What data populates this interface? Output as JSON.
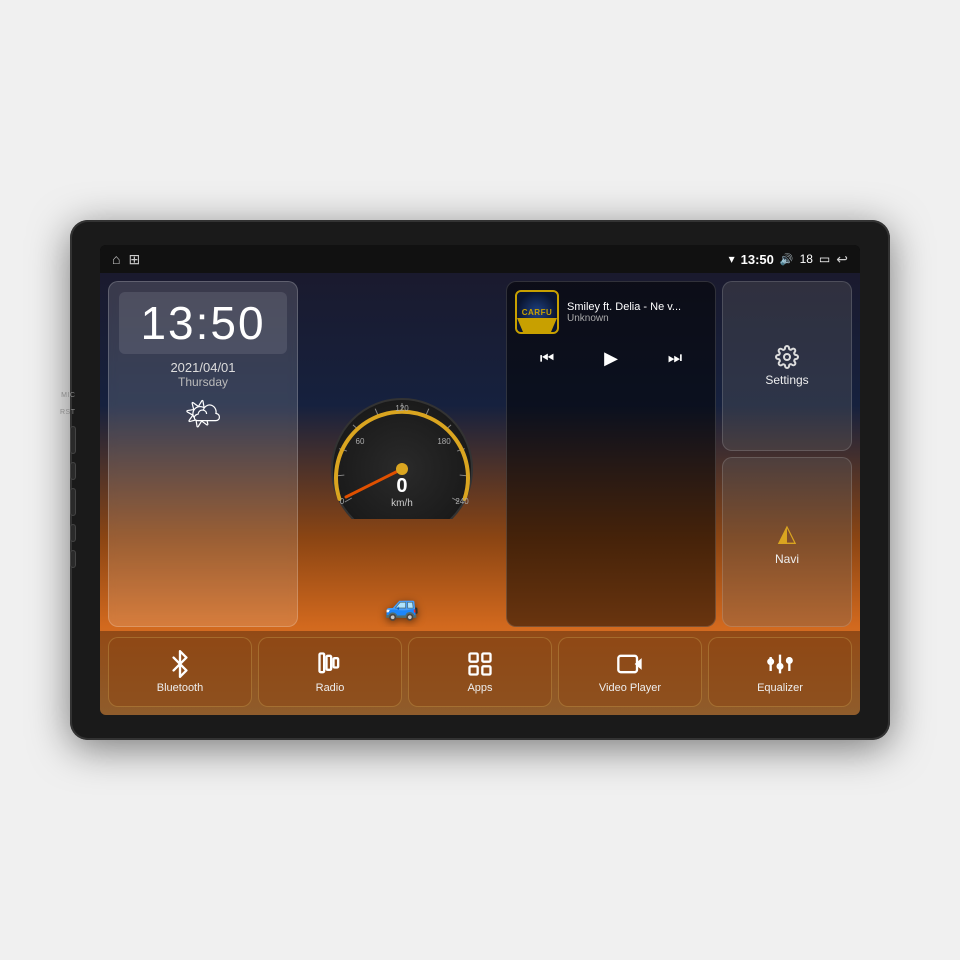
{
  "device": {
    "labels": {
      "mic": "MIC",
      "rst": "RST"
    }
  },
  "statusBar": {
    "time": "13:50",
    "volume": "18",
    "wifi_symbol": "▼",
    "back_symbol": "↩",
    "battery_symbol": "▭",
    "speaker_symbol": "◁)",
    "home_symbol": "⌂",
    "app_symbol": "⊞"
  },
  "clock": {
    "time": "13:50",
    "date": "2021/04/01",
    "day": "Thursday"
  },
  "speedometer": {
    "value": "0",
    "unit": "km/h"
  },
  "music": {
    "title": "Smiley ft. Delia - Ne v...",
    "artist": "Unknown",
    "logo_text": "CARFU"
  },
  "actions": [
    {
      "id": "settings",
      "label": "Settings",
      "icon": "⚙"
    },
    {
      "id": "navi",
      "label": "Navi",
      "icon": "◭"
    }
  ],
  "apps": [
    {
      "id": "bluetooth",
      "label": "Bluetooth",
      "icon": "bluetooth"
    },
    {
      "id": "radio",
      "label": "Radio",
      "icon": "radio"
    },
    {
      "id": "apps",
      "label": "Apps",
      "icon": "apps"
    },
    {
      "id": "video-player",
      "label": "Video Player",
      "icon": "video"
    },
    {
      "id": "equalizer",
      "label": "Equalizer",
      "icon": "equalizer"
    }
  ]
}
